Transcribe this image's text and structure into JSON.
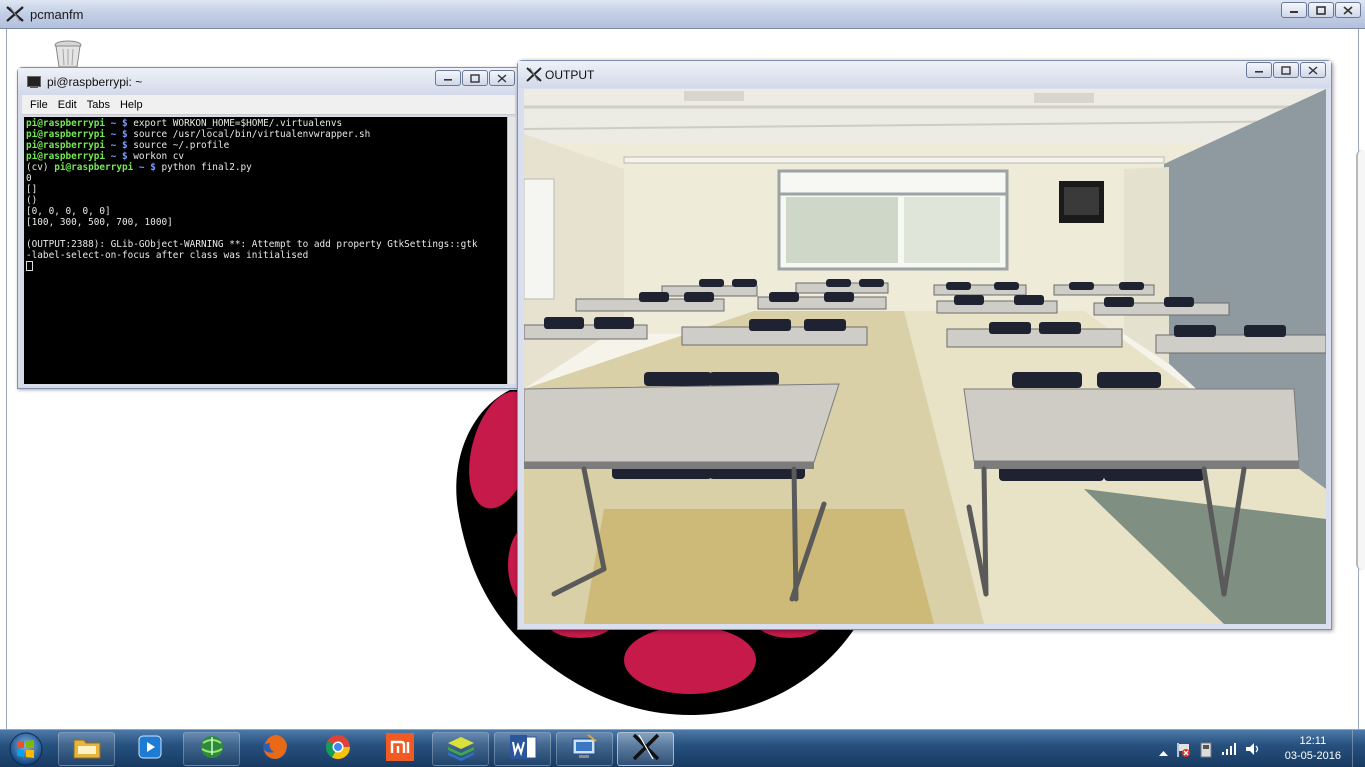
{
  "outer_window": {
    "title": "pcmanfm"
  },
  "terminal": {
    "title": "pi@raspberrypi: ~",
    "menu": [
      "File",
      "Edit",
      "Tabs",
      "Help"
    ],
    "lines": [
      {
        "prompt": "pi@raspberrypi",
        "sep": " ~ $ ",
        "cmd": "export WORKON_HOME=$HOME/.virtualenvs"
      },
      {
        "prompt": "pi@raspberrypi",
        "sep": " ~ $ ",
        "cmd": "source /usr/local/bin/virtualenvwrapper.sh"
      },
      {
        "prompt": "pi@raspberrypi",
        "sep": " ~ $ ",
        "cmd": "source ~/.profile"
      },
      {
        "prompt": "pi@raspberrypi",
        "sep": " ~ $ ",
        "cmd": "workon cv"
      }
    ],
    "venv_line": {
      "prefix": "(cv) ",
      "prompt": "pi@raspberrypi",
      "sep": " ~ $ ",
      "cmd": "python final2.py"
    },
    "output": [
      "0",
      "[]",
      "()",
      "[0, 0, 0, 0, 0]",
      "[100, 300, 500, 700, 1000]",
      "",
      "(OUTPUT:2388): GLib-GObject-WARNING **: Attempt to add property GtkSettings::gtk",
      "-label-select-on-focus after class was initialised"
    ]
  },
  "output_window": {
    "title": "OUTPUT"
  },
  "taskbar": {
    "apps": [
      "windows-explorer",
      "media-player",
      "internet-download-manager",
      "firefox",
      "chrome",
      "mi-pc-suite",
      "bluestacks",
      "microsoft-word",
      "remote-desktop",
      "xming"
    ],
    "clock_time": "12:11",
    "clock_date": "03-05-2016"
  },
  "colors": {
    "prompt_green": "#74e854",
    "prompt_blue": "#7a9cff",
    "taskbar": "#27517f",
    "raspberry": "#c51a4a"
  }
}
